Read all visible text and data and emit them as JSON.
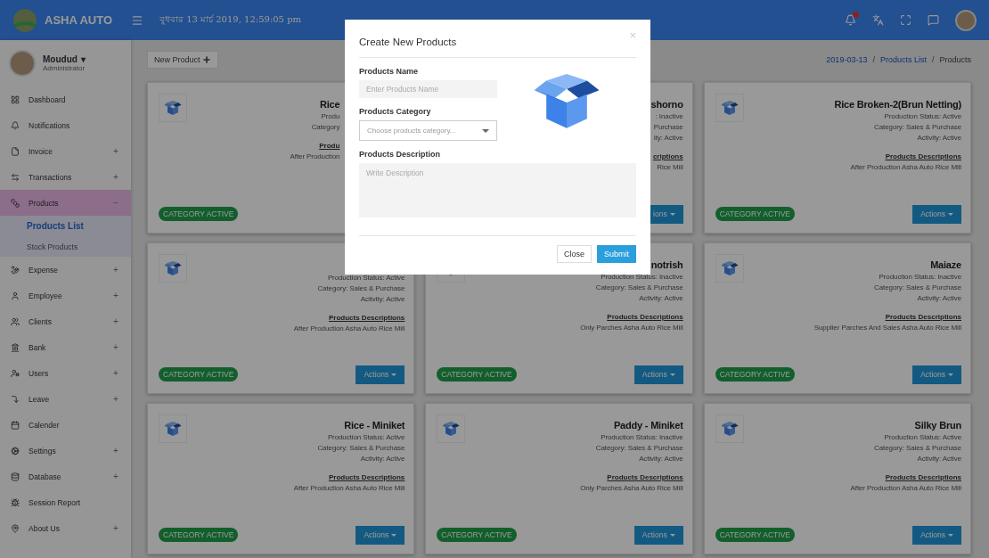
{
  "topbar": {
    "brand": "ASHA AUTO",
    "datetime": "বুধবার 13 মার্চ 2019, 12:59:05 pm",
    "notification_badge": true
  },
  "sidebar": {
    "user": {
      "name": "Moudud",
      "caret": "▾",
      "role": "Administrator"
    },
    "items": [
      {
        "label": "Dashboard"
      },
      {
        "label": "Notifications"
      },
      {
        "label": "Invoice",
        "toggle": "+",
        "expanded": false
      },
      {
        "label": "Transactions",
        "toggle": "+",
        "expanded": false
      },
      {
        "label": "Products",
        "toggle": "−",
        "expanded": true,
        "children": [
          {
            "label": "Products List",
            "selected": true
          },
          {
            "label": "Stock Products",
            "selected": false
          }
        ]
      },
      {
        "label": "Expense",
        "toggle": "+",
        "expanded": false
      },
      {
        "label": "Employee",
        "toggle": "+",
        "expanded": false
      },
      {
        "label": "Clients",
        "toggle": "+",
        "expanded": false
      },
      {
        "label": "Bank",
        "toggle": "+",
        "expanded": false
      },
      {
        "label": "Users",
        "toggle": "+",
        "expanded": false
      },
      {
        "label": "Leave",
        "toggle": "+",
        "expanded": false
      },
      {
        "label": "Calender"
      },
      {
        "label": "Settings",
        "toggle": "+",
        "expanded": false
      },
      {
        "label": "Database",
        "toggle": "+",
        "expanded": false
      },
      {
        "label": "Session Report"
      },
      {
        "label": "About Us",
        "toggle": "+",
        "expanded": false
      }
    ]
  },
  "toolbar": {
    "new_button": "New Product",
    "breadcrumb": {
      "separator": "/",
      "items": [
        "2019-03-13",
        "Products List",
        "Products"
      ]
    }
  },
  "cards": [
    {
      "kind": "left_of_dialog",
      "title": "Rice",
      "lines": [
        "Produ",
        "Category"
      ],
      "desc_heading": "Produ",
      "desc": "After Production",
      "badge": "CATEGORY ACTIVE"
    },
    {
      "kind": "right_of_dialog",
      "title": "shorno",
      "lines": [
        ": Inactive",
        "Purchase",
        "ity: Active"
      ],
      "desc_heading": "criptions",
      "desc": "Rice Mill",
      "actions": "ions"
    },
    {
      "kind": "full",
      "title": "Rice Broken-2(Brun Netting)",
      "lines": [
        "Production Status: Active",
        "Category: Sales & Purchase",
        "Activity: Active"
      ],
      "desc_heading": "Products Descriptions",
      "desc": "After Production Asha Auto Rice Mill",
      "badge": "CATEGORY ACTIVE",
      "actions": "Actions"
    },
    {
      "kind": "full",
      "lines": [
        "Production Status: Active",
        "Category: Sales & Purchase",
        "Activity: Active"
      ],
      "desc_heading": "Products Descriptions",
      "desc": "After Production Asha Auto Rice Mill",
      "badge": "CATEGORY ACTIVE",
      "actions": "Actions"
    },
    {
      "kind": "full",
      "title": "notrish",
      "lines": [
        "Production Status: Inactive",
        "Category: Sales & Purchase",
        "Activity: Active"
      ],
      "desc_heading": "Products Descriptions",
      "desc": "Only Parches Asha Auto Rice Mill",
      "badge": "CATEGORY ACTIVE",
      "actions": "Actions"
    },
    {
      "kind": "full",
      "title": "Maiaze",
      "lines": [
        "Production Status: Inactive",
        "Category: Sales & Purchase",
        "Activity: Active"
      ],
      "desc_heading": "Products Descriptions",
      "desc": "Supplier Parches And Sales Asha Auto Rice Mill",
      "badge": "CATEGORY ACTIVE",
      "actions": "Actions"
    },
    {
      "kind": "full",
      "title": "Rice - Miniket",
      "lines": [
        "Production Status: Active",
        "Category: Sales & Purchase",
        "Activity: Active"
      ],
      "desc_heading": "Products Descriptions",
      "desc": "After Production Asha Auto Rice Mill",
      "badge": "CATEGORY ACTIVE",
      "actions": "Actions"
    },
    {
      "kind": "full",
      "title": "Paddy - Miniket",
      "lines": [
        "Production Status: Inactive",
        "Category: Sales & Purchase",
        "Activity: Active"
      ],
      "desc_heading": "Products Descriptions",
      "desc": "Only Parches Asha Auto Rice Mill",
      "badge": "CATEGORY ACTIVE",
      "actions": "Actions"
    },
    {
      "kind": "full",
      "title": "Silky Brun",
      "lines": [
        "Production Status: Active",
        "Category: Sales & Purchase",
        "Activity: Active"
      ],
      "desc_heading": "Products Descriptions",
      "desc": "After Production Asha Auto Rice Mill",
      "badge": "CATEGORY ACTIVE",
      "actions": "Actions"
    }
  ],
  "dialog": {
    "title": "Create New Products",
    "close_icon": "×",
    "name_label": "Products Name",
    "name_placeholder": "Enter Products Name",
    "category_label": "Products Category",
    "category_placeholder": "Choose products category...",
    "description_label": "Products Description",
    "description_placeholder": "Write Description",
    "buttons": [
      "Close",
      "Submit"
    ]
  }
}
